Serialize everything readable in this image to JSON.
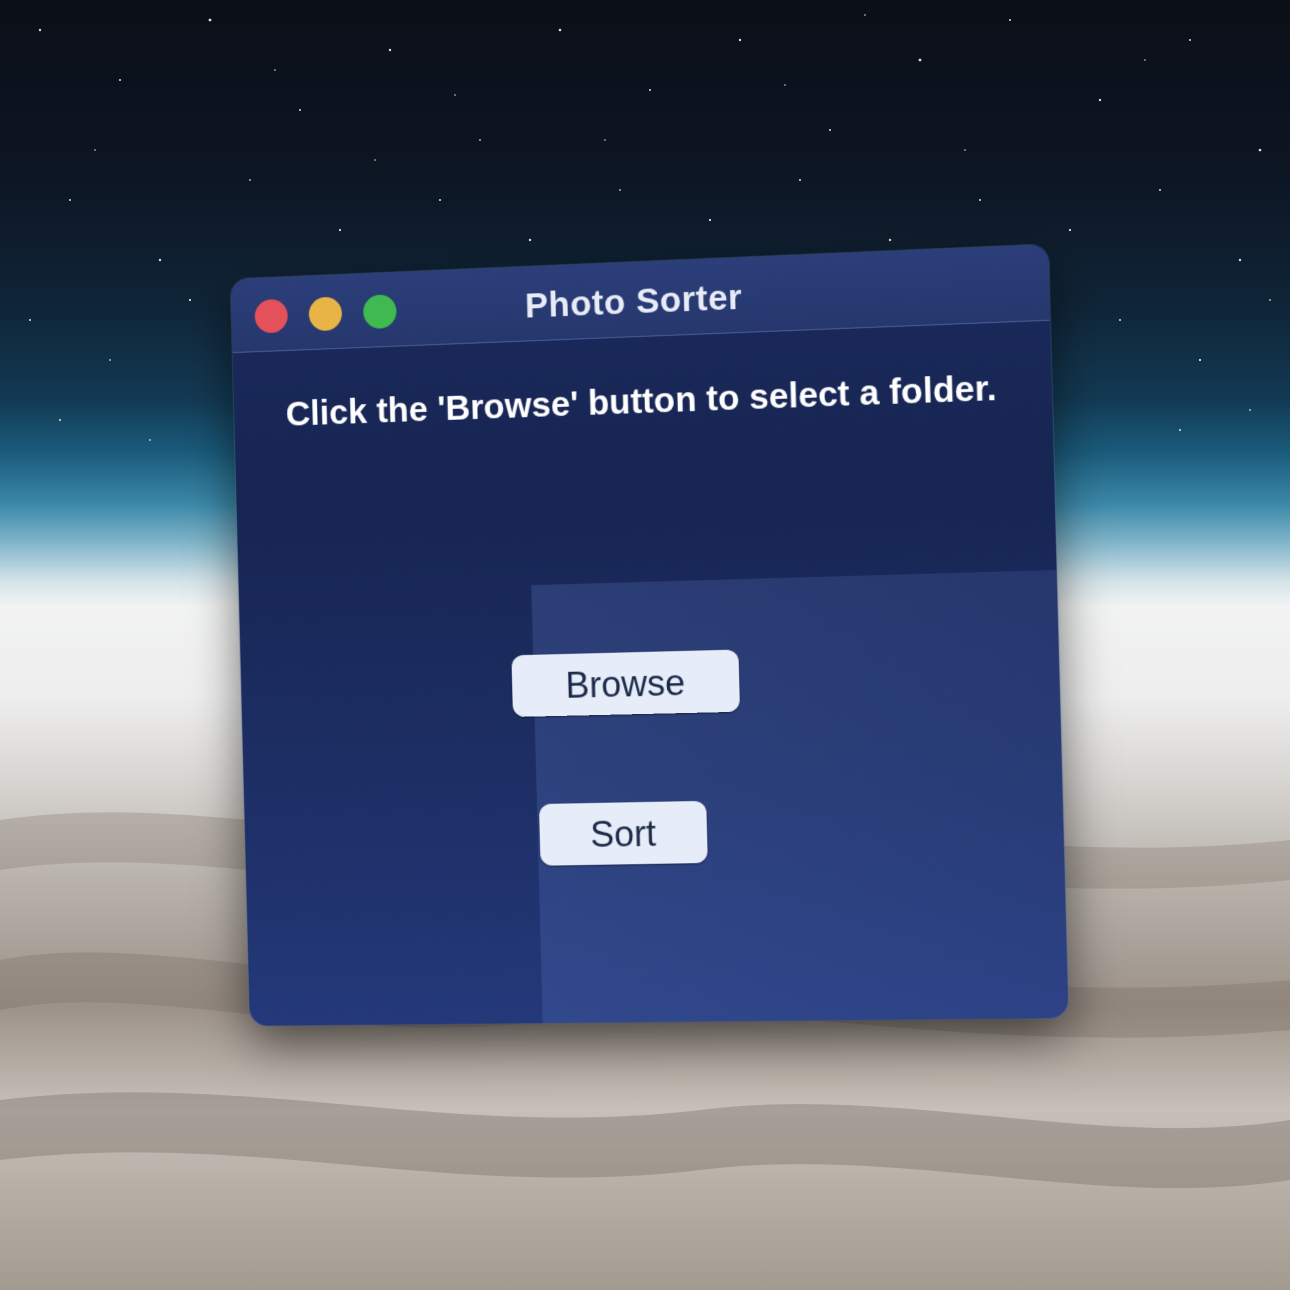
{
  "window": {
    "title": "Photo Sorter",
    "controls": [
      "close",
      "minimize",
      "zoom"
    ]
  },
  "main": {
    "instructions": "Click the 'Browse' button to select a folder.",
    "browse_label": "Browse",
    "sort_label": "Sort"
  },
  "colors": {
    "window_bg": "#1a2a5c",
    "titlebar_bg": "#2c3e7a",
    "close": "#e5515a",
    "minimize": "#e9b446",
    "zoom": "#3fb950",
    "button_bg": "#e6ecf8"
  }
}
